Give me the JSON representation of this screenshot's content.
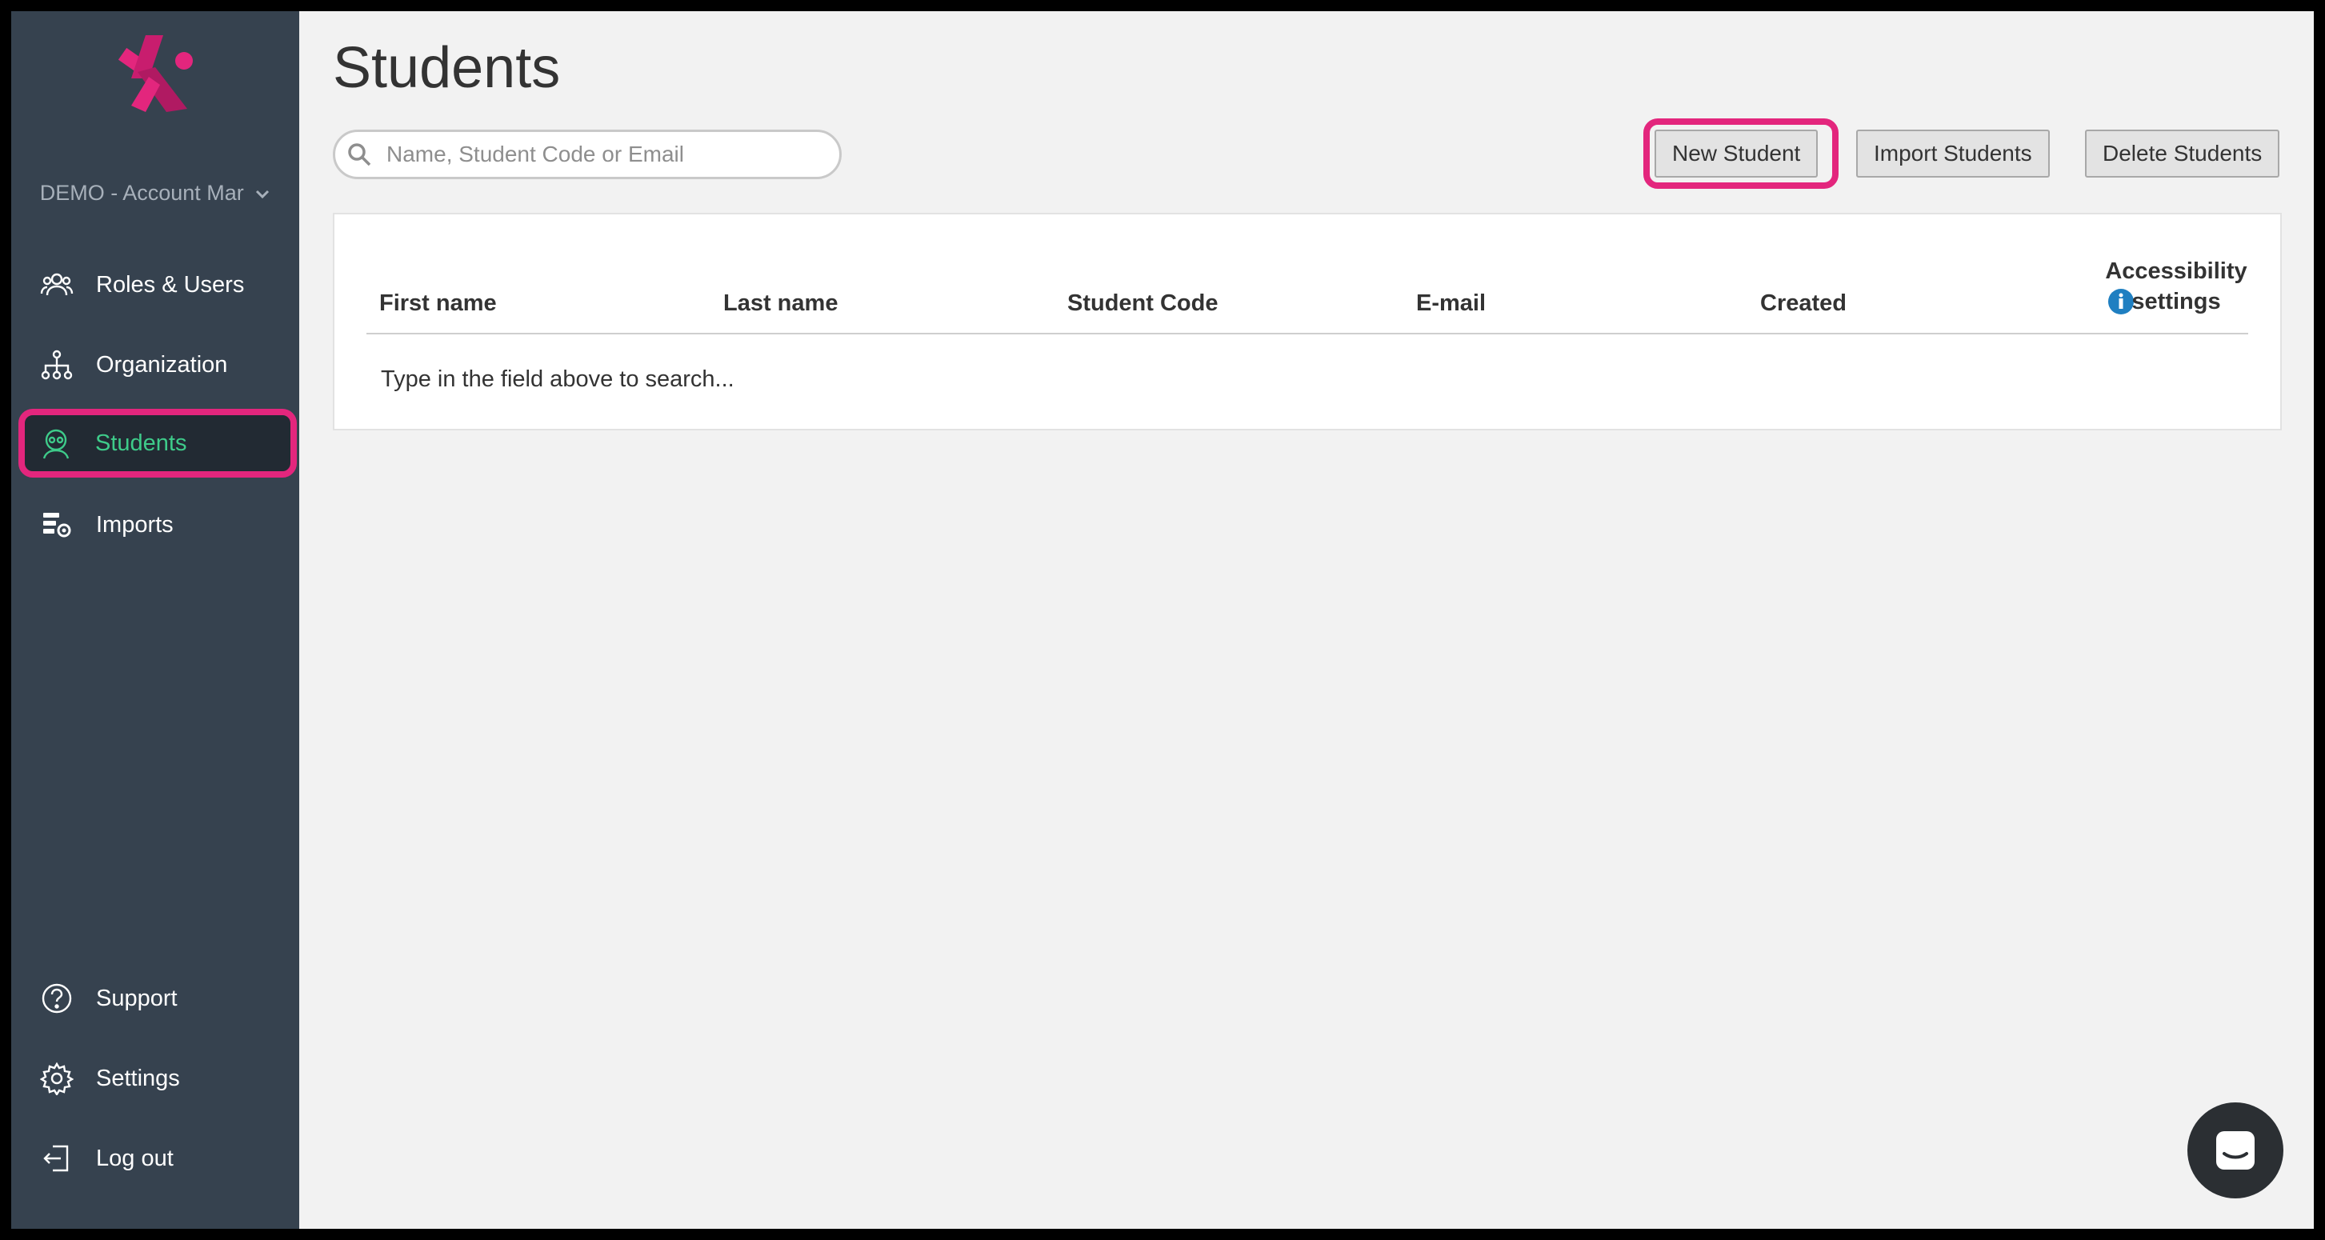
{
  "sidebar": {
    "account_label": "DEMO - Account Mar",
    "nav": [
      {
        "label": "Roles & Users",
        "icon": "users-icon"
      },
      {
        "label": "Organization",
        "icon": "org-chart-icon"
      },
      {
        "label": "Students",
        "icon": "student-icon",
        "active": true
      },
      {
        "label": "Imports",
        "icon": "import-settings-icon"
      }
    ],
    "bottom_nav": [
      {
        "label": "Support",
        "icon": "help-icon"
      },
      {
        "label": "Settings",
        "icon": "gear-icon"
      },
      {
        "label": "Log out",
        "icon": "logout-icon"
      }
    ]
  },
  "header": {
    "title": "Students"
  },
  "search": {
    "placeholder": "Name, Student Code or Email",
    "value": ""
  },
  "toolbar": {
    "new_label": "New Student",
    "import_label": "Import Students",
    "delete_label": "Delete Students"
  },
  "table": {
    "columns": [
      "First name",
      "Last name",
      "Student Code",
      "E-mail",
      "Created"
    ],
    "accessibility_line1": "Accessibility",
    "accessibility_line2": "settings",
    "empty_text": "Type in the field above to search..."
  },
  "colors": {
    "sidebar_bg": "#36424f",
    "accent_pink": "#e3267d",
    "active_green": "#3ecb8a",
    "info_blue": "#1f7fc1"
  }
}
